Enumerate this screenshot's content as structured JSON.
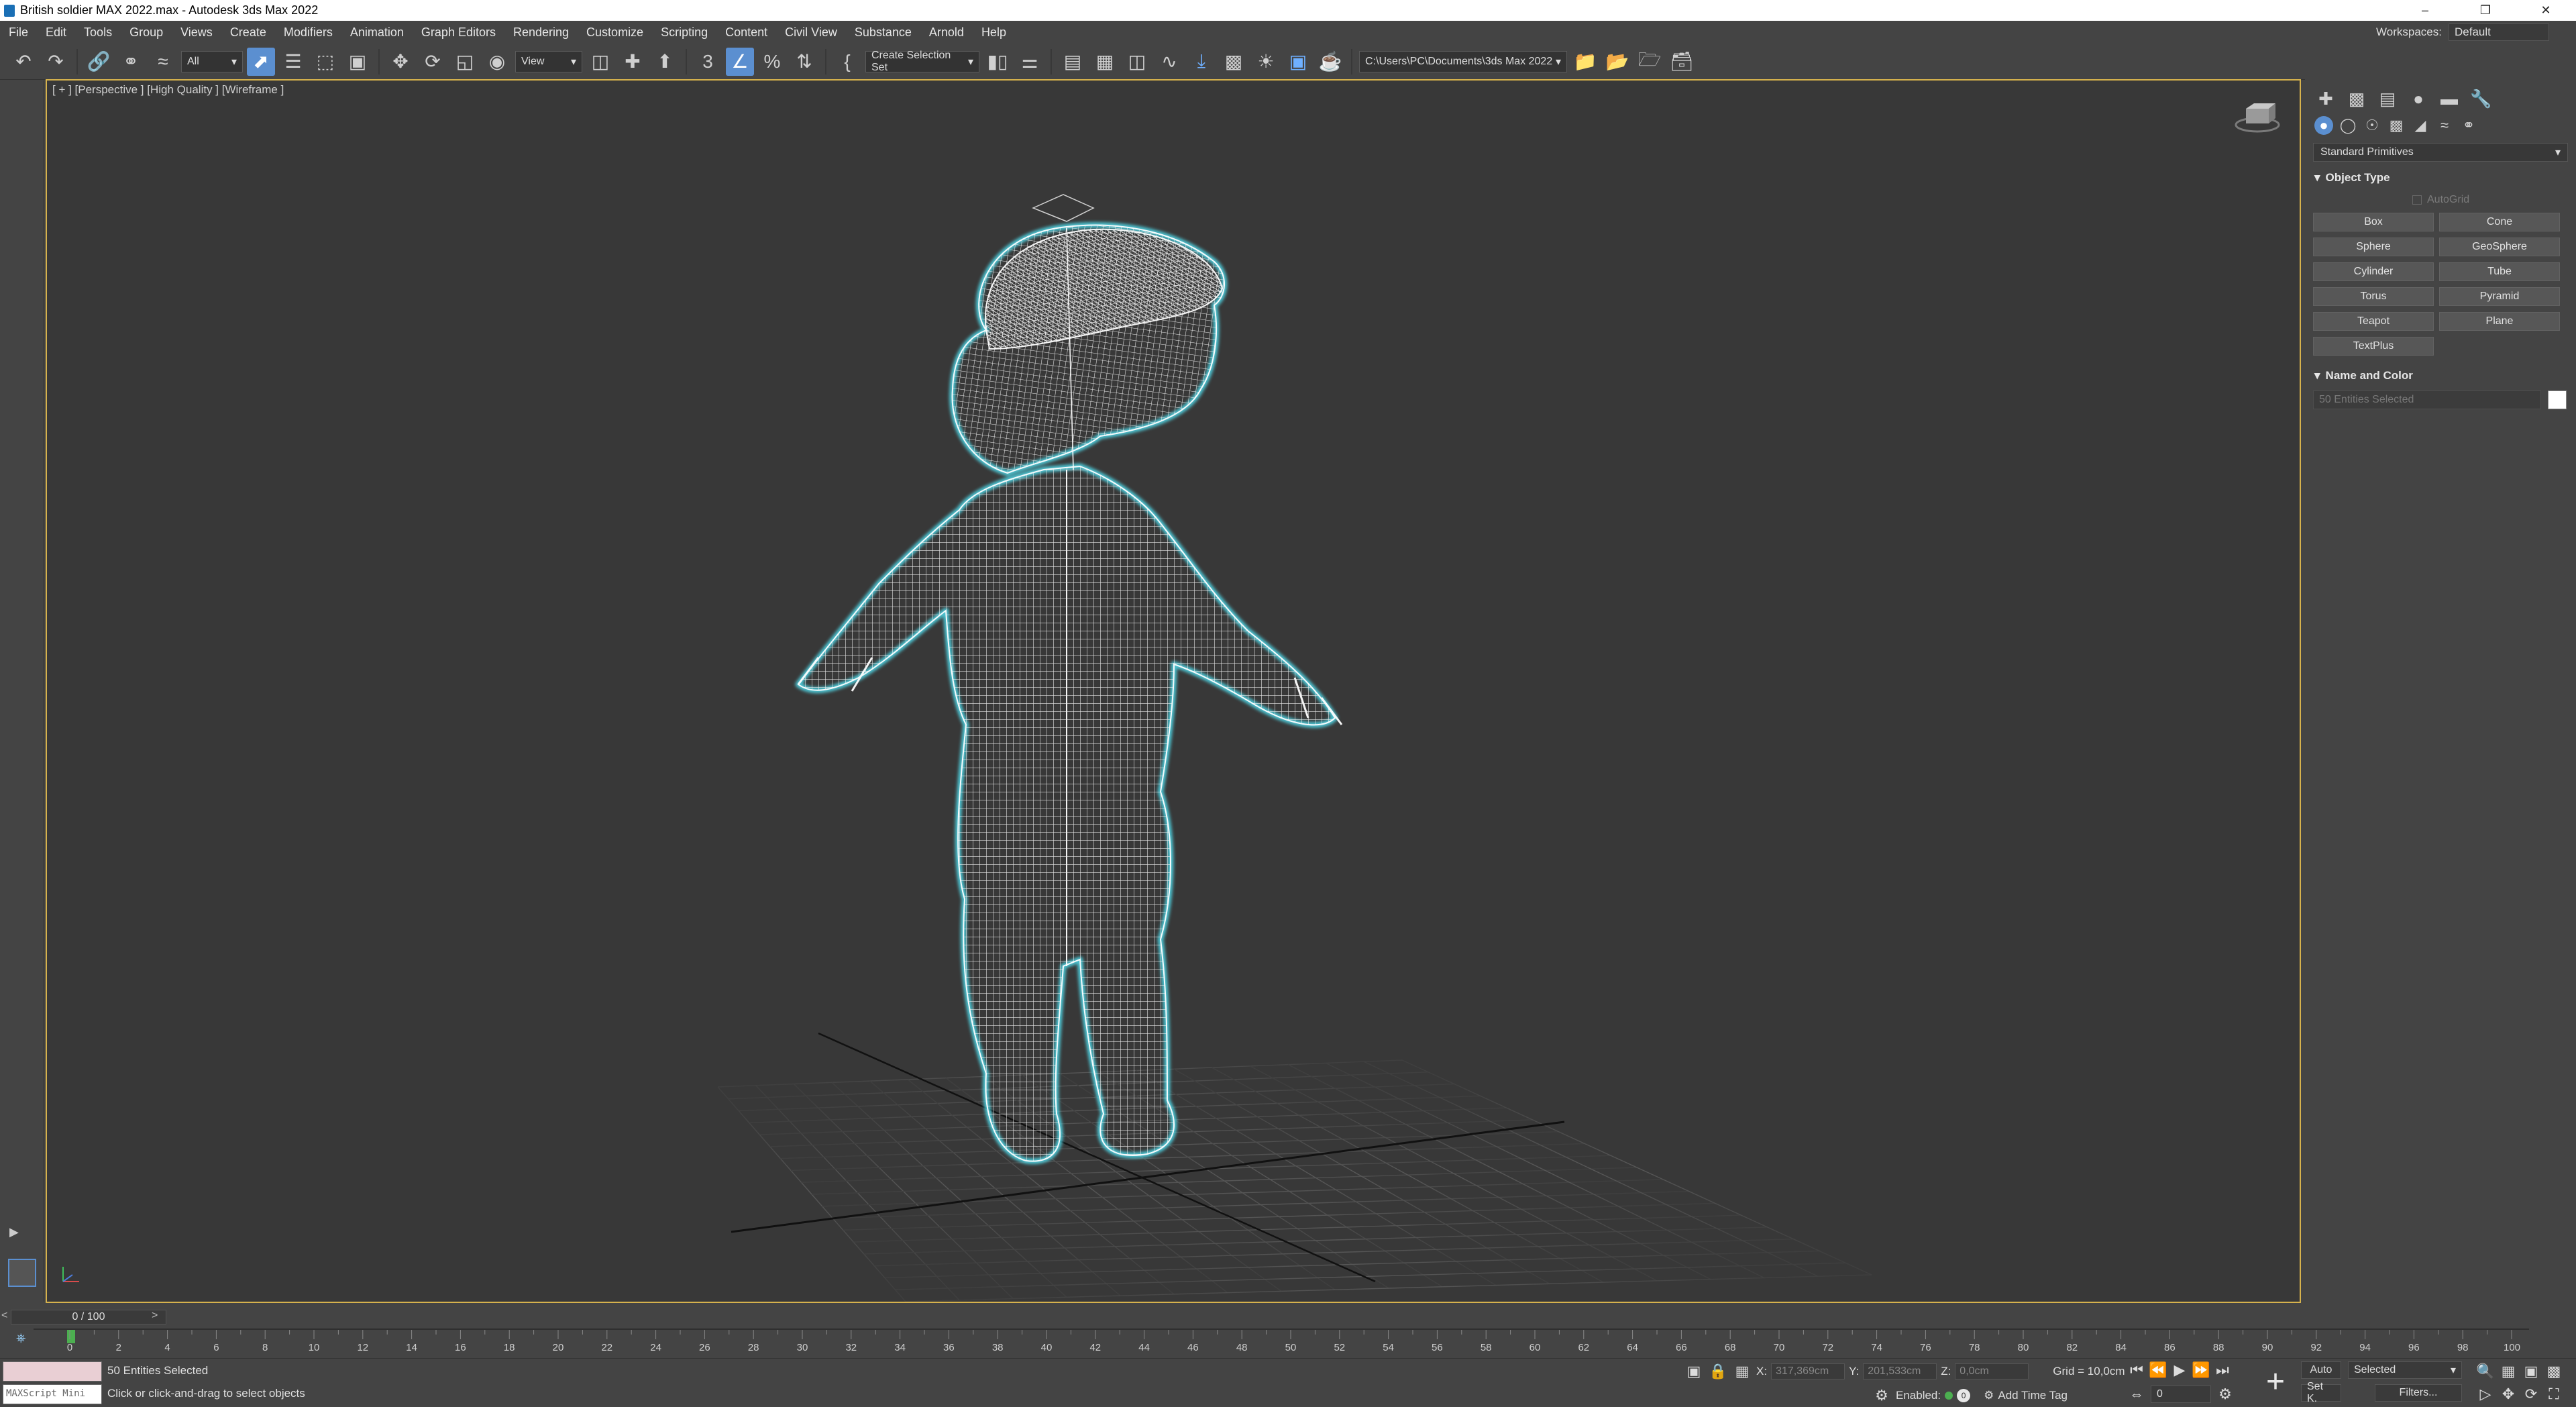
{
  "window": {
    "title": "British soldier MAX 2022.max - Autodesk 3ds Max 2022",
    "minimize_icon": "minimize-icon",
    "restore_icon": "restore-icon",
    "close_icon": "close-icon"
  },
  "menu": {
    "items": [
      "File",
      "Edit",
      "Tools",
      "Group",
      "Views",
      "Create",
      "Modifiers",
      "Animation",
      "Graph Editors",
      "Rendering",
      "Customize",
      "Scripting",
      "Content",
      "Civil View",
      "Substance",
      "Arnold",
      "Help"
    ],
    "workspaces_label": "Workspaces:",
    "workspaces_value": "Default"
  },
  "toolbar": {
    "selection_filter": "All",
    "reference_coord": "View",
    "named_selection": "Create Selection Set",
    "project_path": "C:\\Users\\PC\\Documents\\3ds Max 2022"
  },
  "viewport": {
    "label": "[ + ] [Perspective ] [High Quality ] [Wireframe ]",
    "wire_color": "#ffffff",
    "selection_outline_color": "#4fd8e8",
    "border_color": "#d6b24d"
  },
  "command_panel": {
    "category": "Standard Primitives",
    "object_type_title": "Object Type",
    "autogrid_label": "AutoGrid",
    "buttons": [
      "Box",
      "Cone",
      "Sphere",
      "GeoSphere",
      "Cylinder",
      "Tube",
      "Torus",
      "Pyramid",
      "Teapot",
      "Plane",
      "TextPlus"
    ],
    "name_color_title": "Name and Color",
    "name_value": "50 Entities Selected",
    "object_color": "#ffffff"
  },
  "timeline": {
    "slider_label": "0 / 100",
    "ticks": [
      "0",
      "2",
      "4",
      "6",
      "8",
      "10",
      "12",
      "14",
      "16",
      "18",
      "20",
      "22",
      "24",
      "26",
      "28",
      "30",
      "32",
      "34",
      "36",
      "38",
      "40",
      "42",
      "44",
      "46",
      "48",
      "50",
      "52",
      "54",
      "56",
      "58",
      "60",
      "62",
      "64",
      "66",
      "68",
      "70",
      "72",
      "74",
      "76",
      "78",
      "80",
      "82",
      "84",
      "86",
      "88",
      "90",
      "92",
      "94",
      "96",
      "98",
      "100"
    ]
  },
  "status": {
    "maxscript_placeholder": "MAXScript Mini",
    "selection_text": "50 Entities Selected",
    "prompt_text": "Click or click-and-drag to select objects",
    "x_label": "X:",
    "x_value": "317,369cm",
    "y_label": "Y:",
    "y_value": "201,533cm",
    "z_label": "Z:",
    "z_value": "0,0cm",
    "grid": "Grid = 10,0cm",
    "enabled_label": "Enabled:",
    "add_time_tag": "Add Time Tag",
    "auto_label": "Auto",
    "set_key_label": "Set K.",
    "key_filter_value": "Selected",
    "filters_label": "Filters...",
    "frame_value": "0"
  }
}
